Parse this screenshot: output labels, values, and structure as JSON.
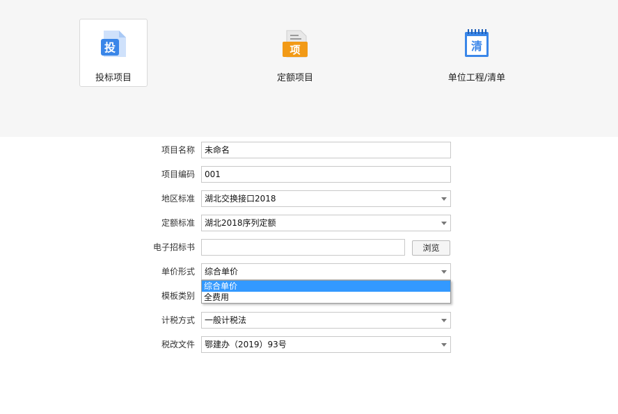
{
  "project_types": [
    {
      "icon": "bid-project-icon",
      "icon_char": "投",
      "label": "投标项目",
      "selected": true,
      "color": "#3a86e8"
    },
    {
      "icon": "quota-project-icon",
      "icon_char": "项",
      "label": "定额项目",
      "selected": false,
      "color": "#f29a16"
    },
    {
      "icon": "bill-list-icon",
      "icon_char": "清",
      "label": "单位工程/清单",
      "selected": false,
      "color": "#3a86e8"
    }
  ],
  "form": {
    "project_name": {
      "label": "项目名称",
      "value": "未命名"
    },
    "project_code": {
      "label": "项目编码",
      "value": "001"
    },
    "region_standard": {
      "label": "地区标准",
      "value": "湖北交换接口2018"
    },
    "quota_standard": {
      "label": "定额标准",
      "value": "湖北2018序列定额"
    },
    "tender_file": {
      "label": "电子招标书",
      "value": "",
      "browse_label": "浏览"
    },
    "unit_price_form": {
      "label": "单价形式",
      "value": "综合单价",
      "options": [
        "综合单价",
        "全费用"
      ],
      "highlighted": "综合单价"
    },
    "template_category": {
      "label": "模板类别"
    },
    "tax_method": {
      "label": "计税方式",
      "value": "一般计税法"
    },
    "tax_reform_file": {
      "label": "税改文件",
      "value": "鄂建办（2019）93号"
    }
  }
}
